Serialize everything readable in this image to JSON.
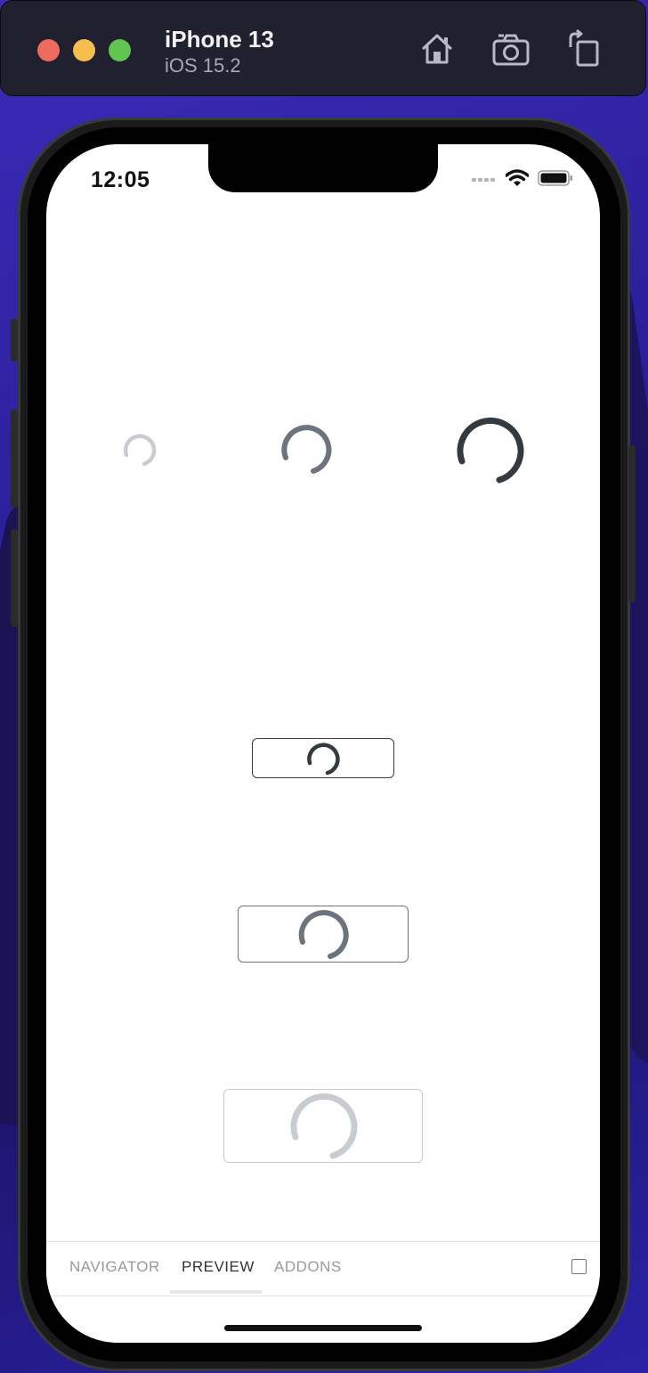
{
  "simulator": {
    "device_name": "iPhone 13",
    "os_version": "iOS 15.2",
    "toolbar_icons": [
      "home-icon",
      "screenshot-icon",
      "rotate-icon"
    ]
  },
  "status_bar": {
    "time": "12:05",
    "icons": [
      "signal-icon",
      "wifi-icon",
      "battery-icon"
    ]
  },
  "spinners_row": [
    {
      "size": "small",
      "color": "#c8ccd0"
    },
    {
      "size": "medium",
      "color": "#6c757d"
    },
    {
      "size": "large",
      "color": "#343a40"
    }
  ],
  "spinner_buttons": [
    {
      "size": "small",
      "color": "#343a40",
      "border": "#343a40"
    },
    {
      "size": "medium",
      "color": "#6c757d",
      "border": "#6c757d"
    },
    {
      "size": "large",
      "color": "#c8ccd0",
      "border": "#c8ccd0"
    }
  ],
  "addons_panel": {
    "tabs": [
      {
        "label": "NAVIGATOR",
        "active": false
      },
      {
        "label": "PREVIEW",
        "active": true
      },
      {
        "label": "ADDONS",
        "active": false
      }
    ],
    "toggle_icon": "panel-toggle-icon"
  },
  "colors": {
    "titlebar_bg": "#20202e",
    "close": "#ec6a5e",
    "minimize": "#f4bf4f",
    "maximize": "#61c554"
  }
}
